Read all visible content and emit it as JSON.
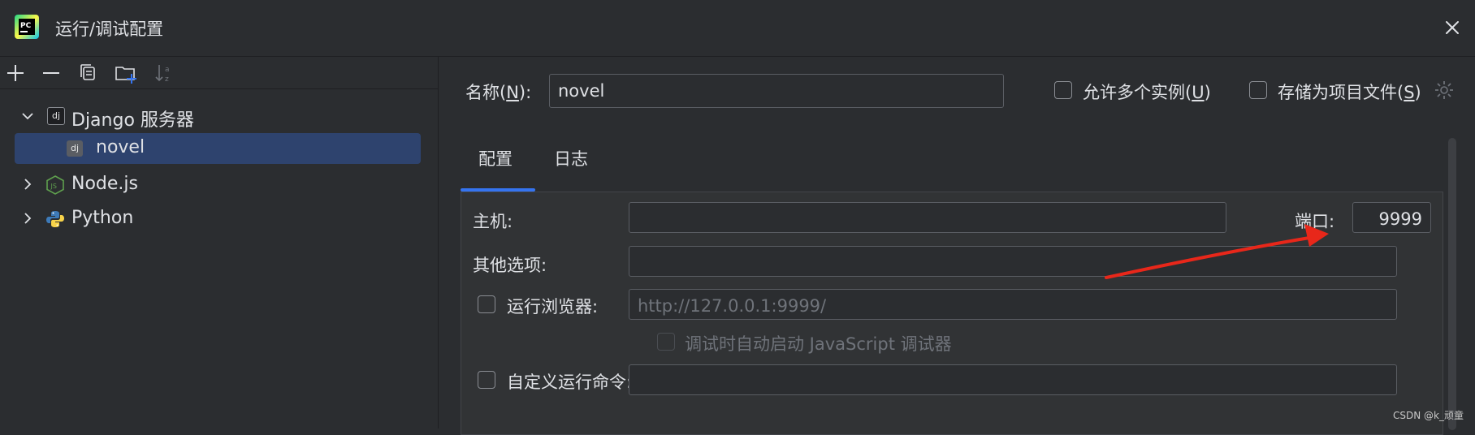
{
  "window": {
    "title": "运行/调试配置",
    "app_icon": "pycharm-logo",
    "app_icon_text": "PC"
  },
  "toolbar": {
    "buttons": [
      "add-icon",
      "remove-icon",
      "copy-icon",
      "new-folder-icon",
      "sort-icon"
    ]
  },
  "tree": {
    "items": [
      {
        "label": "Django 服务器",
        "icon": "django-icon",
        "icon_text": "dj",
        "expanded": true
      },
      {
        "label": "novel",
        "icon": "django-icon",
        "icon_text": "dj",
        "selected": true
      },
      {
        "label": "Node.js",
        "icon": "nodejs-icon",
        "icon_text": "JS",
        "expanded": false
      },
      {
        "label": "Python",
        "icon": "python-icon",
        "expanded": false
      }
    ]
  },
  "form": {
    "name_label_pre": "名称(",
    "name_label_key": "N",
    "name_label_post": "):",
    "name_value": "novel",
    "allow_multiple_pre": "允许多个实例(",
    "allow_multiple_key": "U",
    "allow_multiple_post": ")",
    "store_as_file_pre": "存储为项目文件(",
    "store_as_file_key": "S",
    "store_as_file_post": ")"
  },
  "tabs": [
    {
      "label": "配置",
      "active": true
    },
    {
      "label": "日志",
      "active": false
    }
  ],
  "config": {
    "host_label": "主机:",
    "host_value": "",
    "port_label": "端口:",
    "port_value": "9999",
    "options_label": "其他选项:",
    "options_value": "",
    "run_browser_label": "运行浏览器:",
    "browser_url": "http://127.0.0.1:9999/",
    "js_debugger_label": "调试时自动启动 JavaScript 调试器",
    "custom_cmd_label": "自定义运行命令:",
    "custom_cmd_value": ""
  },
  "colors": {
    "background": "#2b2d30",
    "selection": "#2e436e",
    "tab_accent": "#3574f0",
    "annotation_arrow": "#e8271a"
  },
  "watermark": "CSDN @k_顽童"
}
